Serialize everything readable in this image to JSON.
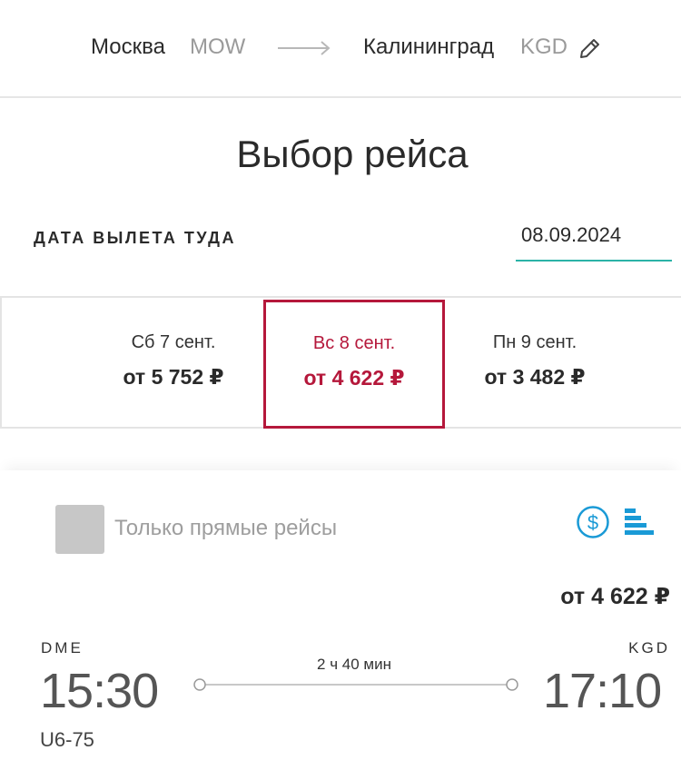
{
  "route": {
    "from_city": "Москва",
    "from_code": "MOW",
    "to_city": "Калининград",
    "to_code": "KGD",
    "edit_icon": "pencil-icon"
  },
  "page": {
    "title": "Выбор рейса"
  },
  "departure": {
    "label": "ДАТА ВЫЛЕТА ТУДА",
    "date": "08.09.2024"
  },
  "days": [
    {
      "label": "Сб 7 сент.",
      "price": "от 5 752 ₽",
      "selected": false
    },
    {
      "label": "Вс 8 сент.",
      "price": "от 4 622 ₽",
      "selected": true
    },
    {
      "label": "Пн 9 сент.",
      "price": "от 3 482 ₽",
      "selected": false
    }
  ],
  "filters": {
    "direct_only_label": "Только прямые рейсы",
    "direct_only_checked": false,
    "sort_price_icon": "dollar-circle-icon",
    "sort_options_icon": "bars-icon"
  },
  "flight": {
    "price": "от 4 622 ₽",
    "dep_airport": "DME",
    "dep_time": "15:30",
    "arr_airport": "KGD",
    "arr_time": "17:10",
    "duration": "2 ч 40 мин",
    "number": "U6-75"
  },
  "colors": {
    "accent_selected": "#b5183b",
    "underline": "#2bb3a7",
    "icon_blue": "#1a9ad6"
  }
}
